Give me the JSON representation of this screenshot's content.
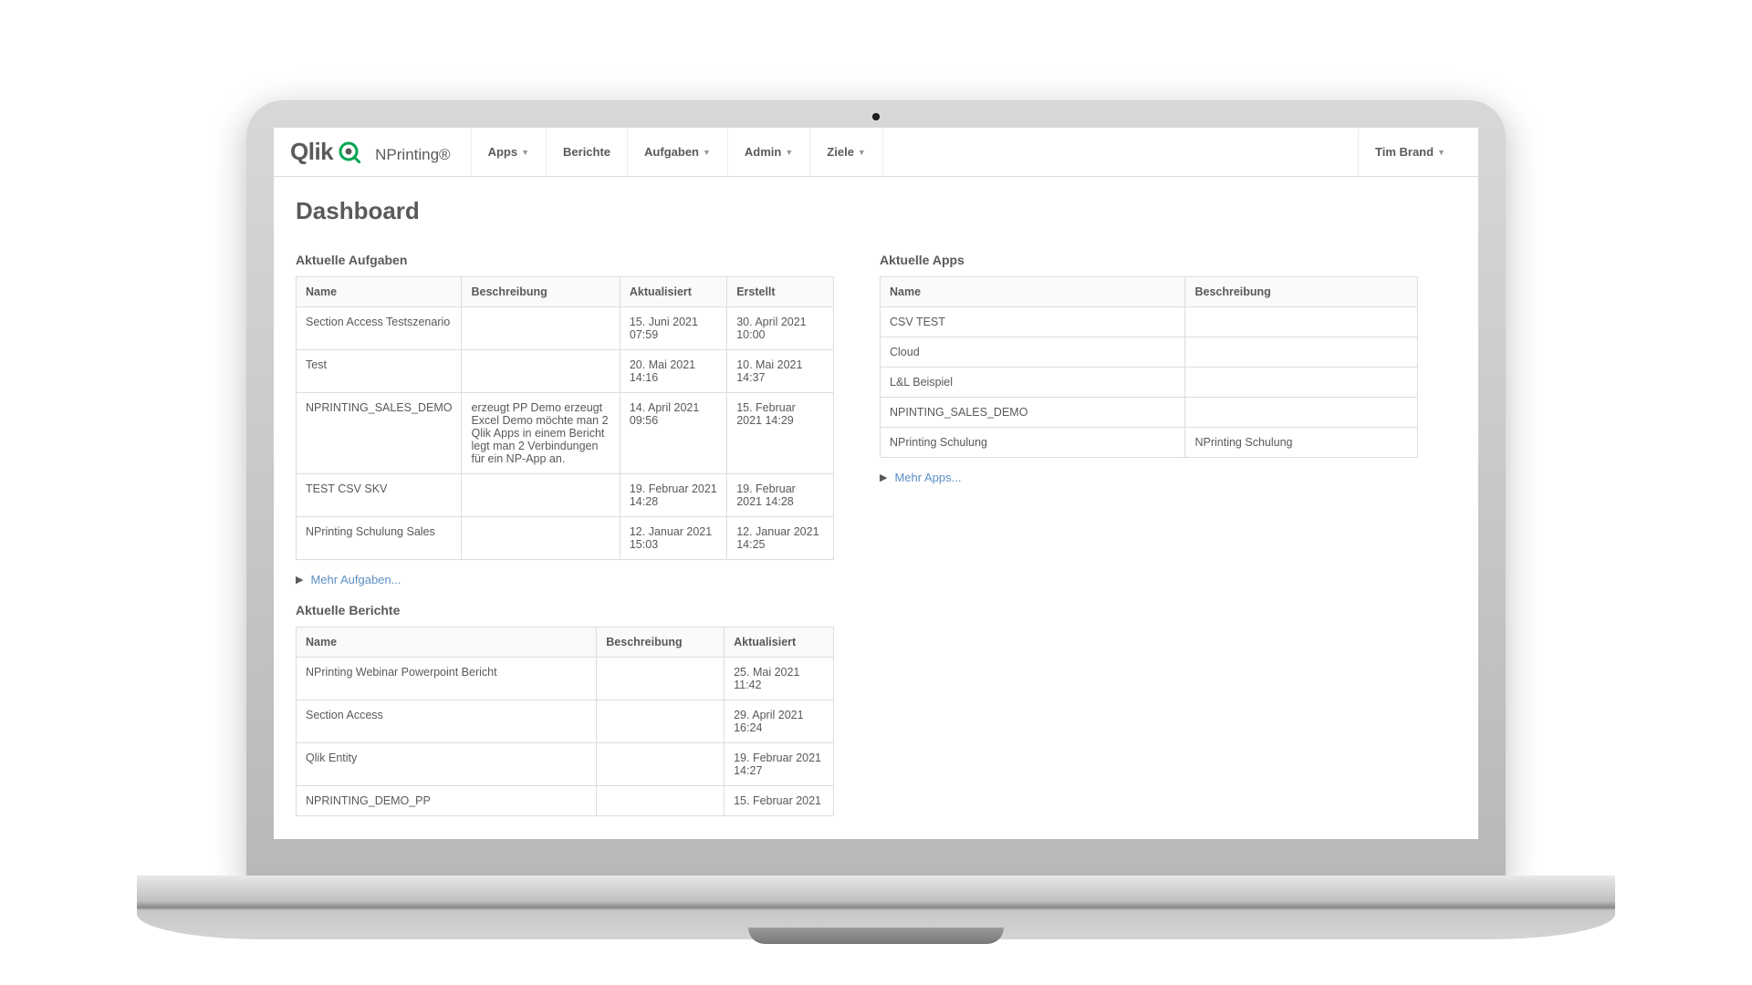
{
  "brand": {
    "qlik": "Qlik",
    "product": "NPrinting®"
  },
  "nav": {
    "apps": "Apps",
    "berichte": "Berichte",
    "aufgaben": "Aufgaben",
    "admin": "Admin",
    "ziele": "Ziele"
  },
  "user": {
    "name": "Tim Brand"
  },
  "page": {
    "title": "Dashboard"
  },
  "tasks": {
    "title": "Aktuelle Aufgaben",
    "headers": {
      "name": "Name",
      "desc": "Beschreibung",
      "updated": "Aktualisiert",
      "created": "Erstellt"
    },
    "rows": [
      {
        "name": "Section Access Testszenario",
        "desc": "",
        "updated": "15. Juni 2021 07:59",
        "created": "30. April 2021 10:00"
      },
      {
        "name": "Test",
        "desc": "",
        "updated": "20. Mai 2021 14:16",
        "created": "10. Mai 2021 14:37"
      },
      {
        "name": "NPRINTING_SALES_DEMO",
        "desc": "erzeugt PP Demo erzeugt Excel Demo möchte man 2 Qlik Apps in einem Bericht legt man 2 Verbindungen für ein NP-App an.",
        "updated": "14. April 2021 09:56",
        "created": "15. Februar 2021 14:29"
      },
      {
        "name": "TEST CSV SKV",
        "desc": "",
        "updated": "19. Februar 2021 14:28",
        "created": "19. Februar 2021 14:28"
      },
      {
        "name": "NPrinting Schulung Sales",
        "desc": "",
        "updated": "12. Januar 2021 15:03",
        "created": "12. Januar 2021 14:25"
      }
    ],
    "more": "Mehr Aufgaben..."
  },
  "reports": {
    "title": "Aktuelle Berichte",
    "headers": {
      "name": "Name",
      "desc": "Beschreibung",
      "updated": "Aktualisiert"
    },
    "rows": [
      {
        "name": "NPrinting Webinar Powerpoint Bericht",
        "desc": "",
        "updated": "25. Mai 2021 11:42"
      },
      {
        "name": "Section Access",
        "desc": "",
        "updated": "29. April 2021 16:24"
      },
      {
        "name": "Qlik Entity",
        "desc": "",
        "updated": "19. Februar 2021 14:27"
      },
      {
        "name": "NPRINTING_DEMO_PP",
        "desc": "",
        "updated": "15. Februar 2021"
      }
    ]
  },
  "apps": {
    "title": "Aktuelle Apps",
    "headers": {
      "name": "Name",
      "desc": "Beschreibung"
    },
    "rows": [
      {
        "name": "CSV TEST",
        "desc": ""
      },
      {
        "name": "Cloud",
        "desc": ""
      },
      {
        "name": "L&L Beispiel",
        "desc": ""
      },
      {
        "name": "NPINTING_SALES_DEMO",
        "desc": ""
      },
      {
        "name": "NPrinting Schulung",
        "desc": "NPrinting Schulung"
      }
    ],
    "more": "Mehr Apps..."
  }
}
